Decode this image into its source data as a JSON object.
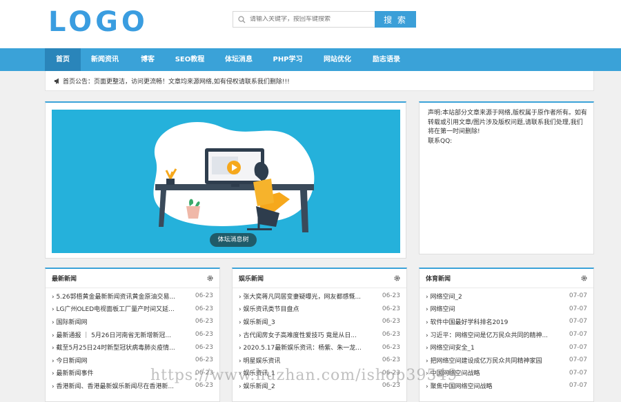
{
  "header": {
    "logo": "LOGO",
    "search_placeholder": "请输入关键字，按回车键搜索",
    "search_button": "搜 索"
  },
  "nav": [
    {
      "label": "首页"
    },
    {
      "label": "新闻资讯"
    },
    {
      "label": "博客"
    },
    {
      "label": "SEO教程"
    },
    {
      "label": "体坛消息"
    },
    {
      "label": "PHP学习"
    },
    {
      "label": "网站优化"
    },
    {
      "label": "励志语录"
    }
  ],
  "notice": {
    "text": "首页公告：页面更整洁，访问更流畅！文章均来源网络,如有侵权请联系我们删除!!!"
  },
  "banner": {
    "caption": "体坛消息树"
  },
  "side": {
    "text": "声明:本站部分文章来源于网络,版权属于原作者所有。如有转载或引用文章/图片涉及版权问题,请联系我们处理,我们将在第一时间删除!\n联系QQ:"
  },
  "panels": [
    {
      "title": "最新新闻",
      "items": [
        {
          "t": "› 5.26郭梧黄金最新新闻资讯黄金原油交易...",
          "d": "06-23"
        },
        {
          "t": "› LG广州OLED电视面板工厂量产时间又延...",
          "d": "06-23"
        },
        {
          "t": "› 国际新闻网",
          "d": "06-23"
        },
        {
          "t": "› 最新通报 ｜ 5月26日河南省无新增新冠...",
          "d": "06-23"
        },
        {
          "t": "› 截至5月25日24时新型冠状病毒肺炎疫情...",
          "d": "06-23"
        },
        {
          "t": "› 今日新闻网",
          "d": "06-23"
        },
        {
          "t": "› 最新新闻事件",
          "d": "06-23"
        },
        {
          "t": "› 香港新闻、香港最新娱乐新闻尽在香港新...",
          "d": "06-23"
        }
      ]
    },
    {
      "title": "娱乐新闻",
      "items": [
        {
          "t": "› 张大奕蒋凡同居变妻疑曝光，网友都感慨...",
          "d": "06-23"
        },
        {
          "t": "› 娱乐资讯类节目盘点",
          "d": "06-23"
        },
        {
          "t": "› 娱乐新闻_3",
          "d": "06-23"
        },
        {
          "t": "› 古代闺房女子高难度性爱技巧 竟是从日...",
          "d": "06-23"
        },
        {
          "t": "› 2020.5.17最新娱乐资讯：杨紫、朱一龙...",
          "d": "06-23"
        },
        {
          "t": "› 明星娱乐资讯",
          "d": "06-23"
        },
        {
          "t": "› 娱乐资讯_1",
          "d": "06-23"
        },
        {
          "t": "› 娱乐新闻_2",
          "d": "06-23"
        }
      ]
    },
    {
      "title": "体育新闻",
      "items": [
        {
          "t": "› 网络空间_2",
          "d": "07-07"
        },
        {
          "t": "› 网络空间",
          "d": "07-07"
        },
        {
          "t": "› 软件中国最好学科排名2019",
          "d": "07-07"
        },
        {
          "t": "› 习近平：网络空间是亿万民众共同的精神...",
          "d": "07-07"
        },
        {
          "t": "› 网络空间安全_1",
          "d": "07-07"
        },
        {
          "t": "› 把网络空间建设成亿万民众共同精神家园",
          "d": "07-07"
        },
        {
          "t": "› 中国网络空间战略",
          "d": "07-07"
        },
        {
          "t": "› 聚焦中国网络空间战略",
          "d": "07-07"
        }
      ]
    }
  ],
  "watermark": "https://www.huzhan.com/ishop39549",
  "colors": {
    "accent": "#3aa2d8",
    "nav_active": "#2a85ba",
    "banner_bg": "#25b1db"
  }
}
